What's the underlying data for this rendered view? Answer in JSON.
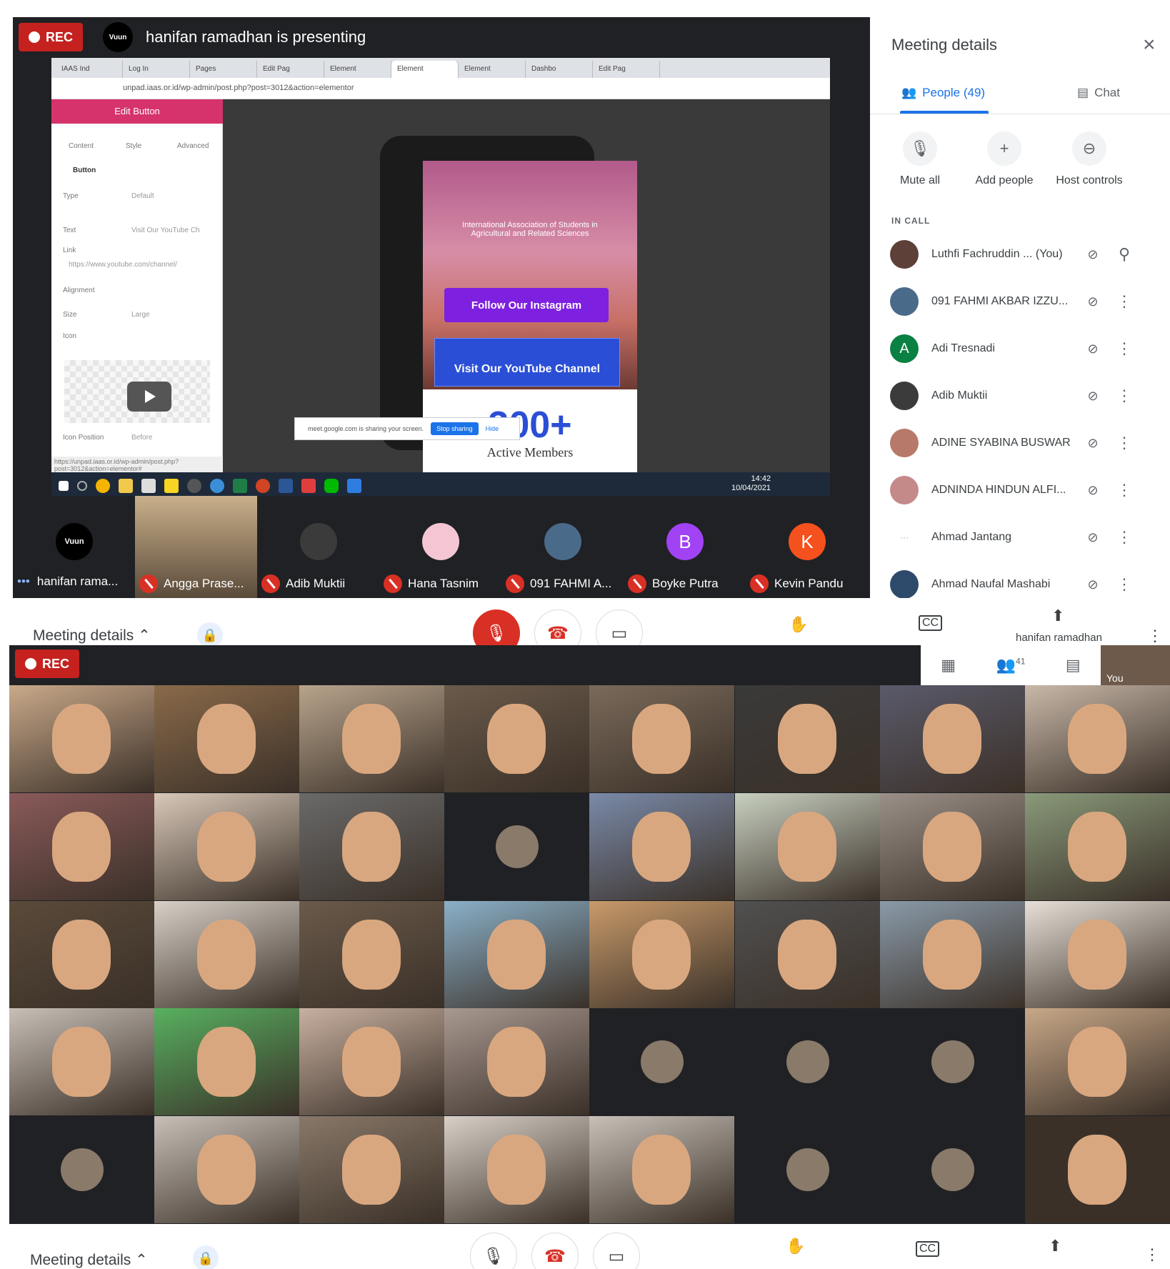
{
  "top": {
    "rec_label": "REC",
    "presenter_badge": "Vuun",
    "presenting_text": "hanifan ramadhan is presenting",
    "browser": {
      "tabs": [
        "IAAS Ind",
        "Log In",
        "Pages",
        "Edit Pag",
        "Element",
        "Element",
        "Element",
        "Dashbo",
        "Edit Pag"
      ],
      "url": "unpad.iaas.or.id/wp-admin/post.php?post=3012&action=elementor",
      "status_url": "https://unpad.iaas.or.id/wp-admin/post.php?post=3012&action=elementor#"
    },
    "elementor": {
      "title": "Edit Button",
      "tabs": [
        "Content",
        "Style",
        "Advanced"
      ],
      "section": "Button",
      "rows": [
        {
          "label": "Type",
          "value": "Default"
        },
        {
          "label": "Text",
          "value": "Visit Our YouTube Ch"
        },
        {
          "label": "Link",
          "value": "https://www.youtube.com/channel/"
        },
        {
          "label": "Alignment",
          "value": ""
        },
        {
          "label": "Size",
          "value": "Large"
        },
        {
          "label": "Icon",
          "value": ""
        },
        {
          "label": "Icon Position",
          "value": "Before"
        }
      ]
    },
    "site": {
      "org_name": "International Association of Students in Agricultural and Related Sciences",
      "instagram_btn": "Follow Our Instagram",
      "youtube_btn": "Visit Our YouTube Channel",
      "stat_value": "300+",
      "stat_label": "Active Members"
    },
    "share_notice": {
      "text": "meet.google.com is sharing your screen.",
      "stop": "Stop sharing",
      "hide": "Hide"
    },
    "clock": {
      "time": "14:42",
      "date": "10/04/2021"
    },
    "filmstrip": [
      {
        "name": "hanifan rama...",
        "avatar_text": "Vuun",
        "color": "#000000"
      },
      {
        "name": "Angga Prase...",
        "avatar_text": "",
        "color": "#7a5a3a"
      },
      {
        "name": "Adib Muktii",
        "avatar_text": "",
        "color": "#3b3b3b"
      },
      {
        "name": "Hana Tasnim",
        "avatar_text": "",
        "color": "#f4c6d4"
      },
      {
        "name": "091 FAHMI A...",
        "avatar_text": "",
        "color": "#4a6a8a"
      },
      {
        "name": "Boyke Putra",
        "avatar_text": "B",
        "color": "#a142f4"
      },
      {
        "name": "Kevin Pandu",
        "avatar_text": "K",
        "color": "#f4511e"
      }
    ]
  },
  "side_panel": {
    "title": "Meeting details",
    "tab_people": "People (49)",
    "tab_chat": "Chat",
    "actions": [
      "Mute all",
      "Add people",
      "Host controls"
    ],
    "in_call_label": "IN CALL",
    "people": [
      {
        "name": "Luthfi Fachruddin ... (You)",
        "avatar": "",
        "color": "#5d4037",
        "trailing": "pin-icon"
      },
      {
        "name": "091 FAHMI AKBAR IZZU...",
        "avatar": "",
        "color": "#4a6a8a",
        "trailing": "more-icon"
      },
      {
        "name": "Adi Tresnadi",
        "avatar": "A",
        "color": "#0b8043",
        "trailing": "more-icon"
      },
      {
        "name": "Adib Muktii",
        "avatar": "",
        "color": "#3b3b3b",
        "trailing": "more-icon"
      },
      {
        "name": "ADINE SYABINA BUSWAR",
        "avatar": "",
        "color": "#b77a6a",
        "trailing": "more-icon"
      },
      {
        "name": "ADNINDA HINDUN ALFI...",
        "avatar": "",
        "color": "#c48a8a",
        "trailing": "more-icon"
      },
      {
        "name": "Ahmad Jantang",
        "avatar": "···",
        "color": "#ffffff",
        "trailing": "more-icon"
      },
      {
        "name": "Ahmad Naufal Mashabi",
        "avatar": "",
        "color": "#2d4a6a",
        "trailing": "more-icon"
      }
    ]
  },
  "controls_top": {
    "meeting_details": "Meeting details",
    "presenter_name": "hanifan ramadhan"
  },
  "grid": {
    "rec_label": "REC",
    "people_count": "41",
    "you_label": "You",
    "tiles": [
      "#c9a98a",
      "#8a6a4a",
      "#b8a48c",
      "#6a5a4a",
      "#7a6a5a",
      "#3a3a3a",
      "#5a5a6a",
      "#c8b8a8",
      "#8a5a5a",
      "#d8c8b8",
      "#6a6a6a",
      "#202124",
      "#7a8aa8",
      "#c8d0c0",
      "#9a9088",
      "#8a9a7a",
      "#5a4a3a",
      "#d8d0c8",
      "#6a5a4a",
      "#8ab0c8",
      "#c89a6a",
      "#505050",
      "#8a9aa8",
      "#e8e0d8",
      "#c8c0b8",
      "#58b060",
      "#c8b0a0",
      "#a89890",
      "#202124",
      "#202124",
      "#202124",
      "#c8a888",
      "#202124",
      "#c8c0b8",
      "#887868",
      "#d8d0c8",
      "#c8c0b8",
      "#202124",
      "#202124",
      "#3a3028"
    ]
  },
  "controls_bottom": {
    "meeting_details": "Meeting details"
  }
}
